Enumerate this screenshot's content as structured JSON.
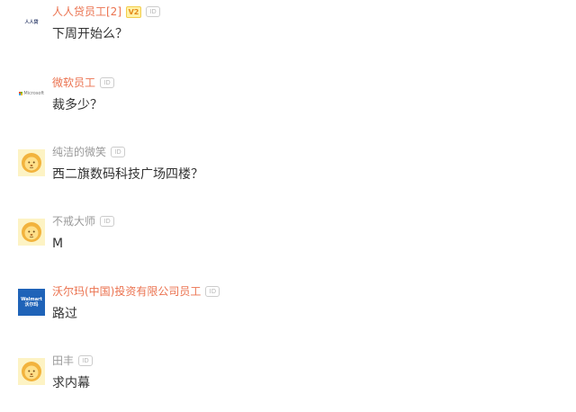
{
  "comments": [
    {
      "username": "人人贷员工[2]",
      "vip": true,
      "badge_v": "V2",
      "badge_id": "ID",
      "avatar_logo": "人人贷",
      "text": "下周开始么？"
    },
    {
      "username": "微软员工",
      "vip": true,
      "badge_id": "ID",
      "avatar_logo": "Microsoft",
      "text": "裁多少？"
    },
    {
      "username": "纯洁的微笑",
      "vip": false,
      "badge_id": "ID",
      "avatar_icon": "lion-mascot-icon",
      "text": "西二旗数码科技广场四楼？"
    },
    {
      "username": "不戒大师",
      "vip": false,
      "badge_id": "ID",
      "avatar_icon": "lion-mascot-icon",
      "text": "M"
    },
    {
      "username": "沃尔玛(中国)投资有限公司员工",
      "vip": true,
      "badge_id": "ID",
      "avatar_logo": "Walmart",
      "avatar_logo_sub": "沃尔玛",
      "text": "路过"
    },
    {
      "username": "田丰",
      "vip": false,
      "badge_id": "ID",
      "avatar_icon": "lion-mascot-icon",
      "text": "求内幕"
    }
  ],
  "colors": {
    "vip_name": "#eb7350",
    "normal_name": "#999999",
    "text": "#333333",
    "walmart_blue": "#1f63b8"
  }
}
